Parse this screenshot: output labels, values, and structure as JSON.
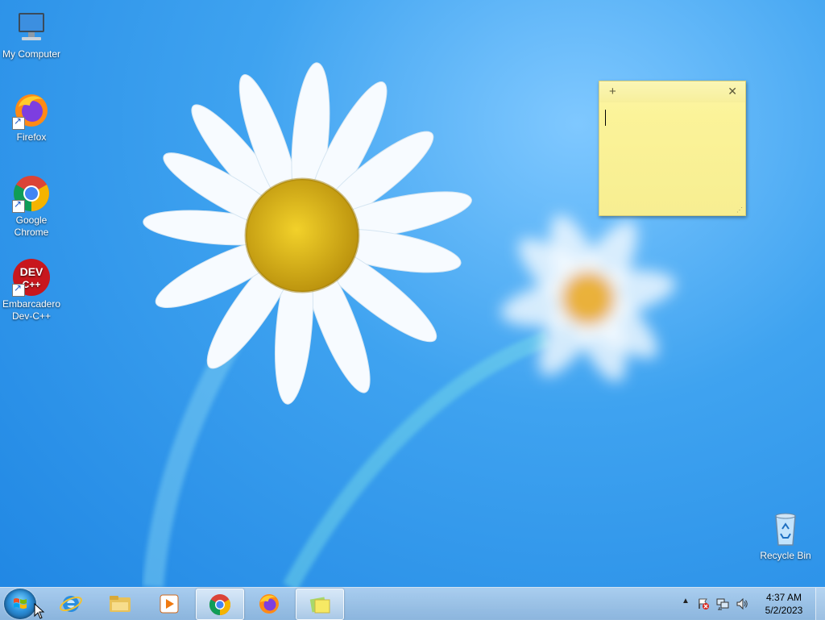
{
  "desktop": {
    "icons": [
      {
        "label": "My Computer",
        "icon": "computer-icon"
      },
      {
        "label": "Firefox",
        "icon": "firefox-icon"
      },
      {
        "label": "Google Chrome",
        "icon": "chrome-icon"
      },
      {
        "label": "Embarcadero Dev-C++",
        "icon": "devcpp-icon"
      },
      {
        "label": "Recycle Bin",
        "icon": "recycle-bin-icon"
      }
    ],
    "devcpp_logo_text": "DEV C++"
  },
  "sticky_note": {
    "add_label": "+",
    "close_label": "✕",
    "content": "",
    "color": "#fbf399"
  },
  "taskbar": {
    "items": [
      {
        "name": "internet-explorer",
        "icon": "ie-icon",
        "active": false
      },
      {
        "name": "file-explorer",
        "icon": "folder-icon",
        "active": false
      },
      {
        "name": "media-player",
        "icon": "media-player-icon",
        "active": false
      },
      {
        "name": "google-chrome",
        "icon": "chrome-icon",
        "active": true
      },
      {
        "name": "firefox",
        "icon": "firefox-icon",
        "active": false
      },
      {
        "name": "sticky-notes",
        "icon": "sticky-notes-icon",
        "active": true
      }
    ],
    "tray": {
      "show_hidden_label": "▲",
      "icons": [
        "action-center-icon",
        "network-icon",
        "volume-icon"
      ]
    },
    "clock": {
      "time": "4:37 AM",
      "date": "5/2/2023"
    }
  },
  "colors": {
    "desktop_bg": "#2a8fe6",
    "taskbar": "#a9c8e6"
  }
}
